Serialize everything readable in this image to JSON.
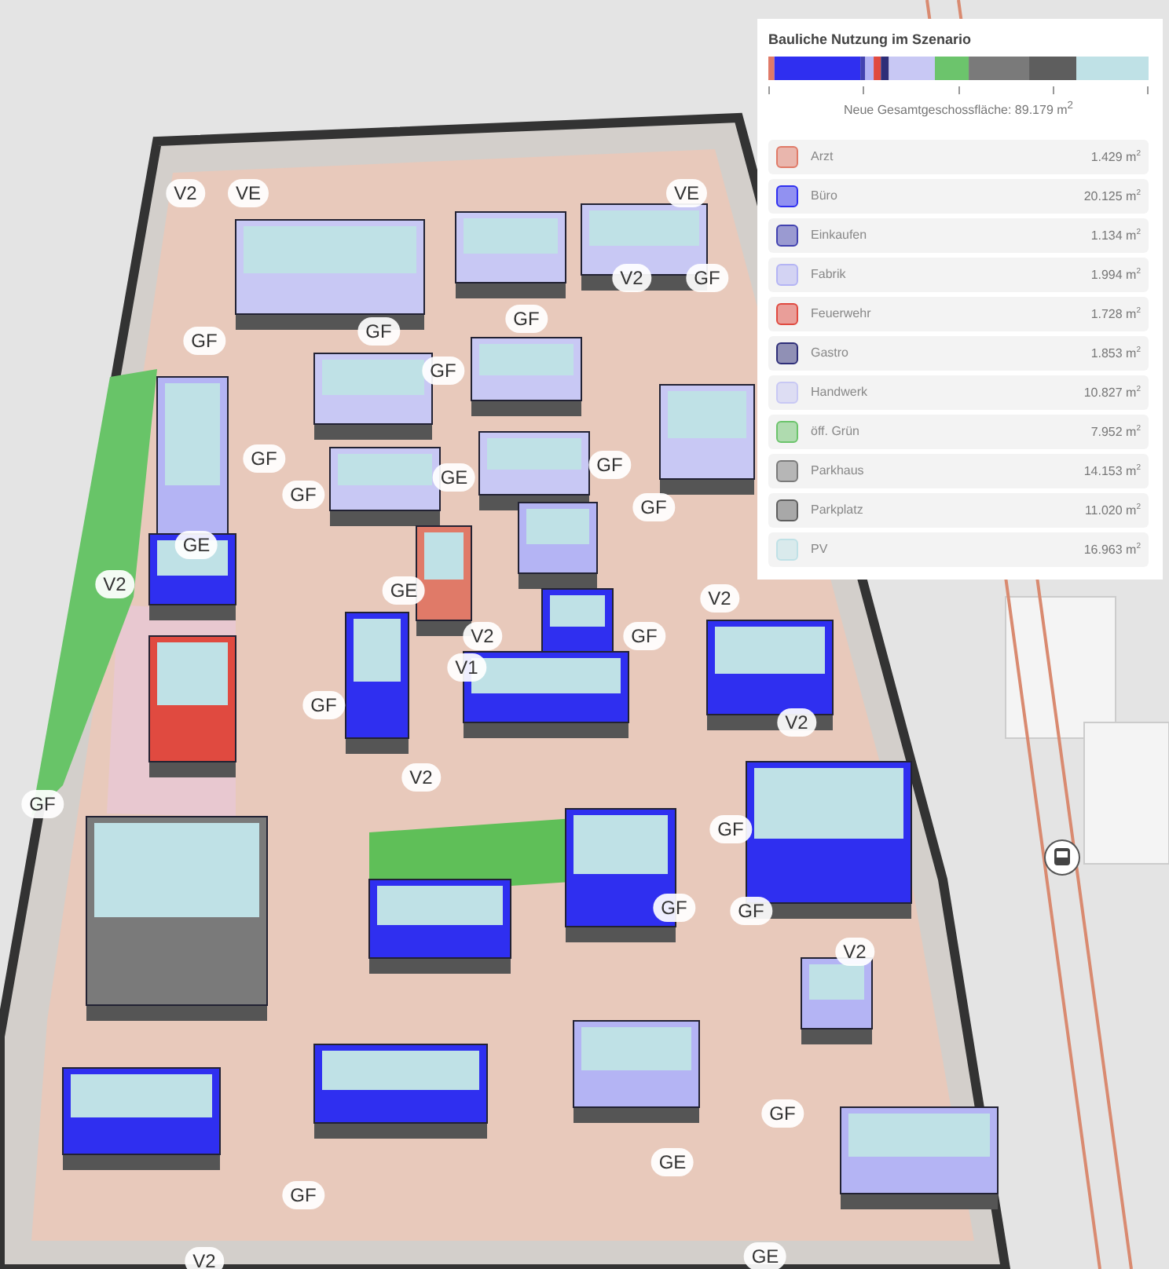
{
  "legend": {
    "title": "Bauliche Nutzung im Szenario",
    "total": "Neue Gesamtgeschossfläche: 89.179 m$^{2}$",
    "items": [
      {
        "name": "Arzt",
        "area": "1.429 m$^{2}$",
        "color": "#e07a68"
      },
      {
        "name": "Büro",
        "area": "20.125 m$^{2}$",
        "color": "#2f2ff0"
      },
      {
        "name": "Einkaufen",
        "area": "1.134 m$^{2}$",
        "color": "#4242b0"
      },
      {
        "name": "Fabrik",
        "area": "1.994 m$^{2}$",
        "color": "#b4b4f4"
      },
      {
        "name": "Feuerwehr",
        "area": "1.728 m$^{2}$",
        "color": "#e04a40"
      },
      {
        "name": "Gastro",
        "area": "1.853 m$^{2}$",
        "color": "#2e2e78"
      },
      {
        "name": "Handwerk",
        "area": "10.827 m$^{2}$",
        "color": "#c8c8f4"
      },
      {
        "name": "öff. Grün",
        "area": "7.952 m$^{2}$",
        "color": "#6cc46c"
      },
      {
        "name": "Parkhaus",
        "area": "14.153 m$^{2}$",
        "color": "#7a7a7a"
      },
      {
        "name": "Parkplatz",
        "area": "11.020 m$^{2}$",
        "color": "#5e5e5e"
      },
      {
        "name": "PV",
        "area": "16.963 m$^{2}$",
        "color": "#bfe1e6"
      }
    ]
  },
  "map_labels": [
    "V2",
    "VE",
    "VE",
    "V2",
    "GF",
    "GF",
    "GF",
    "GF",
    "GF",
    "GF",
    "GE",
    "GF",
    "GF",
    "GF",
    "GE",
    "V2",
    "GE",
    "V2",
    "V2",
    "GF",
    "V1",
    "GF",
    "V2",
    "V2",
    "GF",
    "GF",
    "GF",
    "GF",
    "V2",
    "GF",
    "GE",
    "GF",
    "GE",
    "V2"
  ]
}
